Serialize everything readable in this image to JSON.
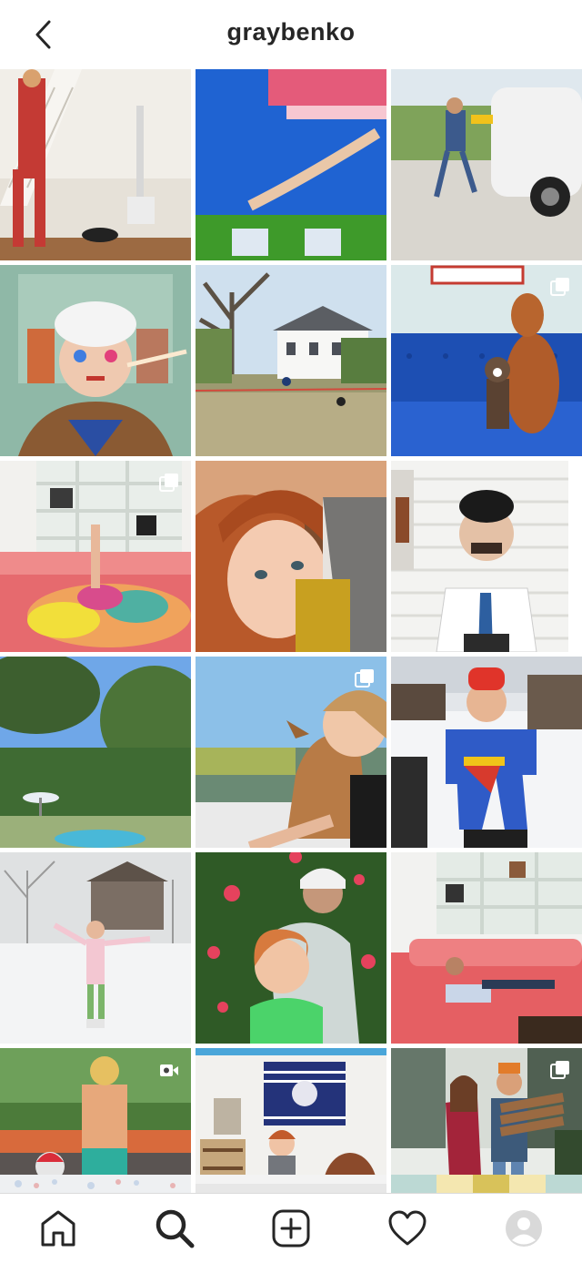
{
  "header": {
    "username": "graybenko",
    "back_icon": "chevron-left-icon"
  },
  "grid": {
    "tiles": [
      {
        "name": "post-1",
        "multi": false
      },
      {
        "name": "post-2",
        "multi": false
      },
      {
        "name": "post-3",
        "multi": false
      },
      {
        "name": "post-4",
        "multi": false
      },
      {
        "name": "post-5",
        "multi": false
      },
      {
        "name": "post-6",
        "multi": true
      },
      {
        "name": "post-7",
        "multi": true
      },
      {
        "name": "post-8",
        "multi": false
      },
      {
        "name": "post-9",
        "multi": false
      },
      {
        "name": "post-10",
        "multi": false
      },
      {
        "name": "post-11",
        "multi": true
      },
      {
        "name": "post-12",
        "multi": false
      },
      {
        "name": "post-13",
        "multi": false
      },
      {
        "name": "post-14",
        "multi": false
      },
      {
        "name": "post-15",
        "multi": false
      },
      {
        "name": "post-16",
        "video": true
      },
      {
        "name": "post-17",
        "multi": false
      },
      {
        "name": "post-18",
        "multi": true
      }
    ]
  },
  "nav": {
    "items": [
      "home-icon",
      "search-icon",
      "new-post-icon",
      "heart-icon",
      "profile-avatar-icon"
    ],
    "active": "search-icon"
  },
  "colors": {
    "text": "#262626",
    "border": "#dbdbdb",
    "background": "#ffffff"
  }
}
